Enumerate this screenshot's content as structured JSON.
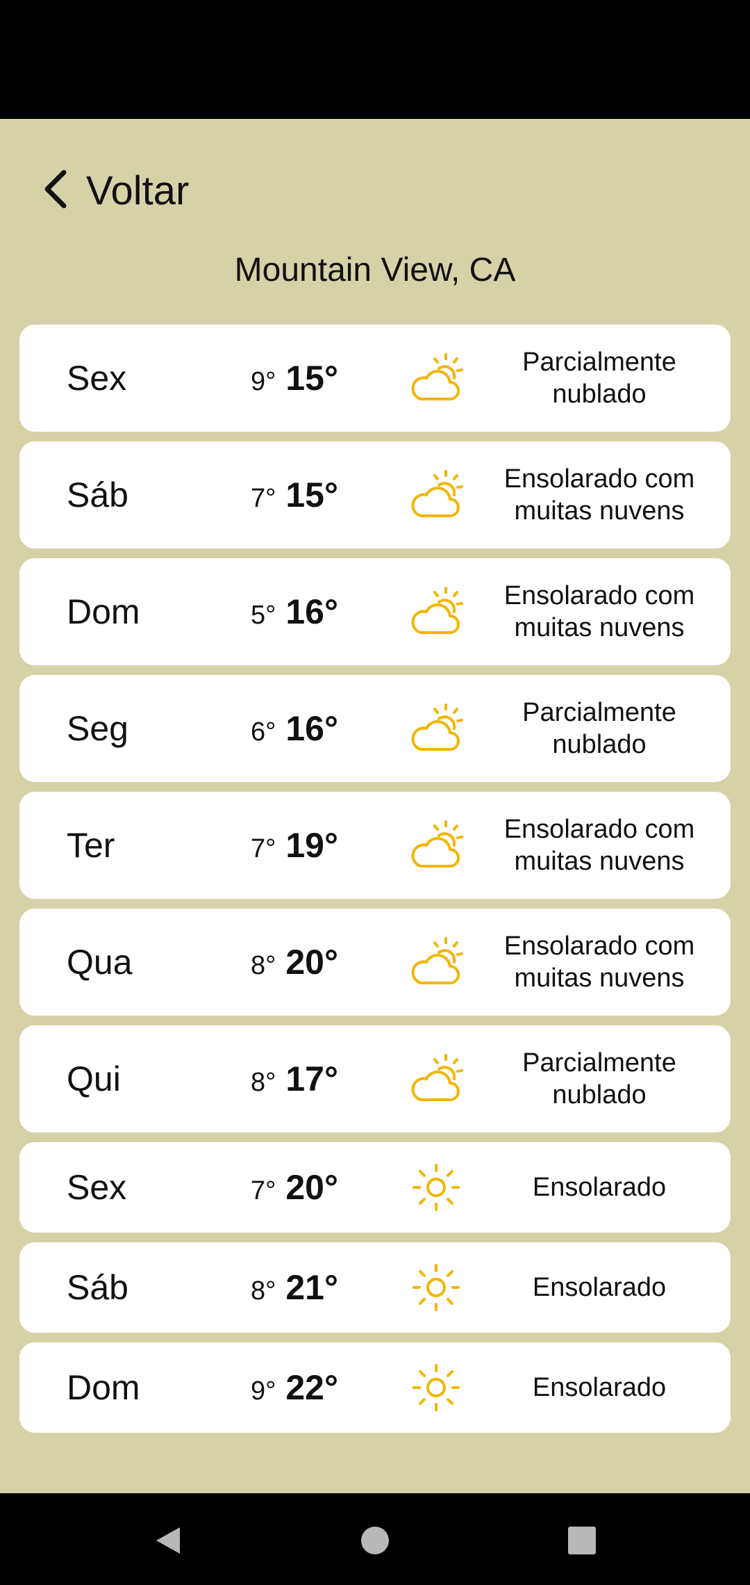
{
  "header": {
    "back_label": "Voltar"
  },
  "location": "Mountain View, CA",
  "forecast": [
    {
      "day": "Sex",
      "min": "9°",
      "max": "15°",
      "icon": "partly-cloudy-icon",
      "desc": "Parcialmente nublado"
    },
    {
      "day": "Sáb",
      "min": "7°",
      "max": "15°",
      "icon": "partly-cloudy-icon",
      "desc": "Ensolarado com muitas nuvens"
    },
    {
      "day": "Dom",
      "min": "5°",
      "max": "16°",
      "icon": "partly-cloudy-icon",
      "desc": "Ensolarado com muitas nuvens"
    },
    {
      "day": "Seg",
      "min": "6°",
      "max": "16°",
      "icon": "partly-cloudy-icon",
      "desc": "Parcialmente nublado"
    },
    {
      "day": "Ter",
      "min": "7°",
      "max": "19°",
      "icon": "partly-cloudy-icon",
      "desc": "Ensolarado com muitas nuvens"
    },
    {
      "day": "Qua",
      "min": "8°",
      "max": "20°",
      "icon": "partly-cloudy-icon",
      "desc": "Ensolarado com muitas nuvens"
    },
    {
      "day": "Qui",
      "min": "8°",
      "max": "17°",
      "icon": "partly-cloudy-icon",
      "desc": "Parcialmente nublado"
    },
    {
      "day": "Sex",
      "min": "7°",
      "max": "20°",
      "icon": "sun-icon",
      "desc": "Ensolarado"
    },
    {
      "day": "Sáb",
      "min": "8°",
      "max": "21°",
      "icon": "sun-icon",
      "desc": "Ensolarado"
    },
    {
      "day": "Dom",
      "min": "9°",
      "max": "22°",
      "icon": "sun-icon",
      "desc": "Ensolarado"
    }
  ],
  "colors": {
    "background": "#d6d2a8",
    "card": "#ffffff",
    "icon_accent": "#f5b400"
  },
  "nav": {
    "back_icon": "triangle-back-icon",
    "home_icon": "circle-home-icon",
    "recents_icon": "square-recents-icon"
  }
}
